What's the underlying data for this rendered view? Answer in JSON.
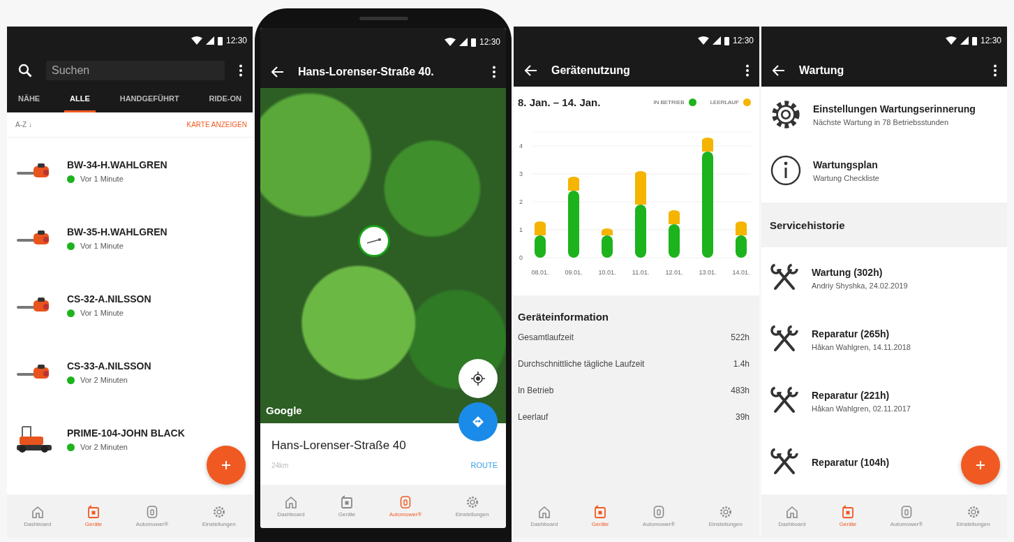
{
  "screens": [
    {
      "kind": "device_list",
      "status_time": "12:30",
      "search": {
        "placeholder": "Suchen"
      },
      "tabs": [
        {
          "label": "NÄHE",
          "selected": false
        },
        {
          "label": "ALLE",
          "selected": true
        },
        {
          "label": "HANDGEFÜHRT",
          "selected": false
        },
        {
          "label": "RIDE-ON",
          "selected": false
        }
      ],
      "sort_label": "A-Z ↓",
      "map_link": "KARTE ANZEIGEN",
      "devices": [
        {
          "kind": "handheld",
          "name": "BW-34-H.WAHLGREN",
          "status": "Vor 1 Minute",
          "color": "#1db31d"
        },
        {
          "kind": "handheld",
          "name": "BW-35-H.WAHLGREN",
          "status": "Vor 1 Minute",
          "color": "#1db31d"
        },
        {
          "kind": "handheld",
          "name": "CS-32-A.NILSSON",
          "status": "Vor 1 Minute",
          "color": "#1db31d"
        },
        {
          "kind": "handheld",
          "name": "CS-33-A.NILSSON",
          "status": "Vor 2 Minuten",
          "color": "#1db31d"
        },
        {
          "kind": "ride_on",
          "name": "PRIME-104-JOHN BLACK",
          "status": "Vor 2 Minuten",
          "color": "#1db31d"
        }
      ],
      "bottom_nav": [
        {
          "label": "Dashboard",
          "selected": false
        },
        {
          "label": "Geräte",
          "selected": true
        },
        {
          "label": "Automower®",
          "selected": false
        },
        {
          "label": "Einstellungen",
          "selected": false
        }
      ]
    },
    {
      "kind": "map",
      "status_time": "12:30",
      "title": "Hans-Lorenser-Straße 40.",
      "map_attribution": "Google",
      "address": "Hans-Lorenser-Straße 40",
      "distance": "24km",
      "route": "ROUTE",
      "bottom_nav": [
        {
          "label": "Dashboard",
          "selected": false
        },
        {
          "label": "Geräte",
          "selected": false
        },
        {
          "label": "Automower®",
          "selected": true
        },
        {
          "label": "Einstellungen",
          "selected": false
        }
      ]
    },
    {
      "kind": "usage",
      "status_time": "12:30",
      "title": "Gerätenutzung",
      "date_range": "8. Jan. – 14. Jan.",
      "chart_data": {
        "type": "bar",
        "stacked": true,
        "grid": true,
        "ylim": [
          0,
          4.5
        ],
        "categories": [
          "08.01.",
          "09.01.",
          "10.01.",
          "11.01.",
          "12.01.",
          "13.01.",
          "14.01."
        ],
        "yticks": [
          0,
          1,
          2,
          3,
          4
        ],
        "series": [
          {
            "name": "IN BETRIEB",
            "color": "#1db31d",
            "values": [
              0.8,
              2.4,
              0.8,
              1.9,
              1.2,
              3.8,
              0.8
            ]
          },
          {
            "name": "LEERLAUF",
            "color": "#f5b400",
            "values": [
              0.5,
              0.5,
              0.25,
              1.2,
              0.5,
              0.5,
              0.5
            ]
          }
        ]
      },
      "info_title": "Geräteinformation",
      "info_rows": [
        {
          "label": "Gesamtlaufzeit",
          "value": "522h"
        },
        {
          "label": "Durchschnittliche tägliche Laufzeit",
          "value": "1.4h"
        },
        {
          "label": "In Betrieb",
          "value": "483h"
        },
        {
          "label": "Leerlauf",
          "value": "39h"
        }
      ],
      "bottom_nav": [
        {
          "label": "Dashboard",
          "selected": false
        },
        {
          "label": "Geräte",
          "selected": true
        },
        {
          "label": "Automower®",
          "selected": false
        },
        {
          "label": "Einstellungen",
          "selected": false
        }
      ]
    },
    {
      "kind": "maintenance",
      "status_time": "12:30",
      "title": "Wartung",
      "settings": [
        {
          "title": "Einstellungen Wartungserinnerung",
          "subtitle": "Nächste Wartung in 78 Betriebsstunden"
        },
        {
          "title": "Wartungsplan",
          "subtitle": "Wartung Checkliste"
        }
      ],
      "history_title": "Servicehistorie",
      "history": [
        {
          "title": "Wartung (302h)",
          "subtitle": "Andriy Shyshka, 24.02.2019"
        },
        {
          "title": "Reparatur (265h)",
          "subtitle": "Håkan Wahlgren, 14.11.2018"
        },
        {
          "title": "Reparatur (221h)",
          "subtitle": "Håkan Wahlgren, 02.11.2017"
        },
        {
          "title": "Reparatur (104h)"
        }
      ],
      "bottom_nav": [
        {
          "label": "Dashboard",
          "selected": false
        },
        {
          "label": "Geräte",
          "selected": true
        },
        {
          "label": "Automower®",
          "selected": false
        },
        {
          "label": "Einstellungen",
          "selected": false
        }
      ]
    }
  ]
}
